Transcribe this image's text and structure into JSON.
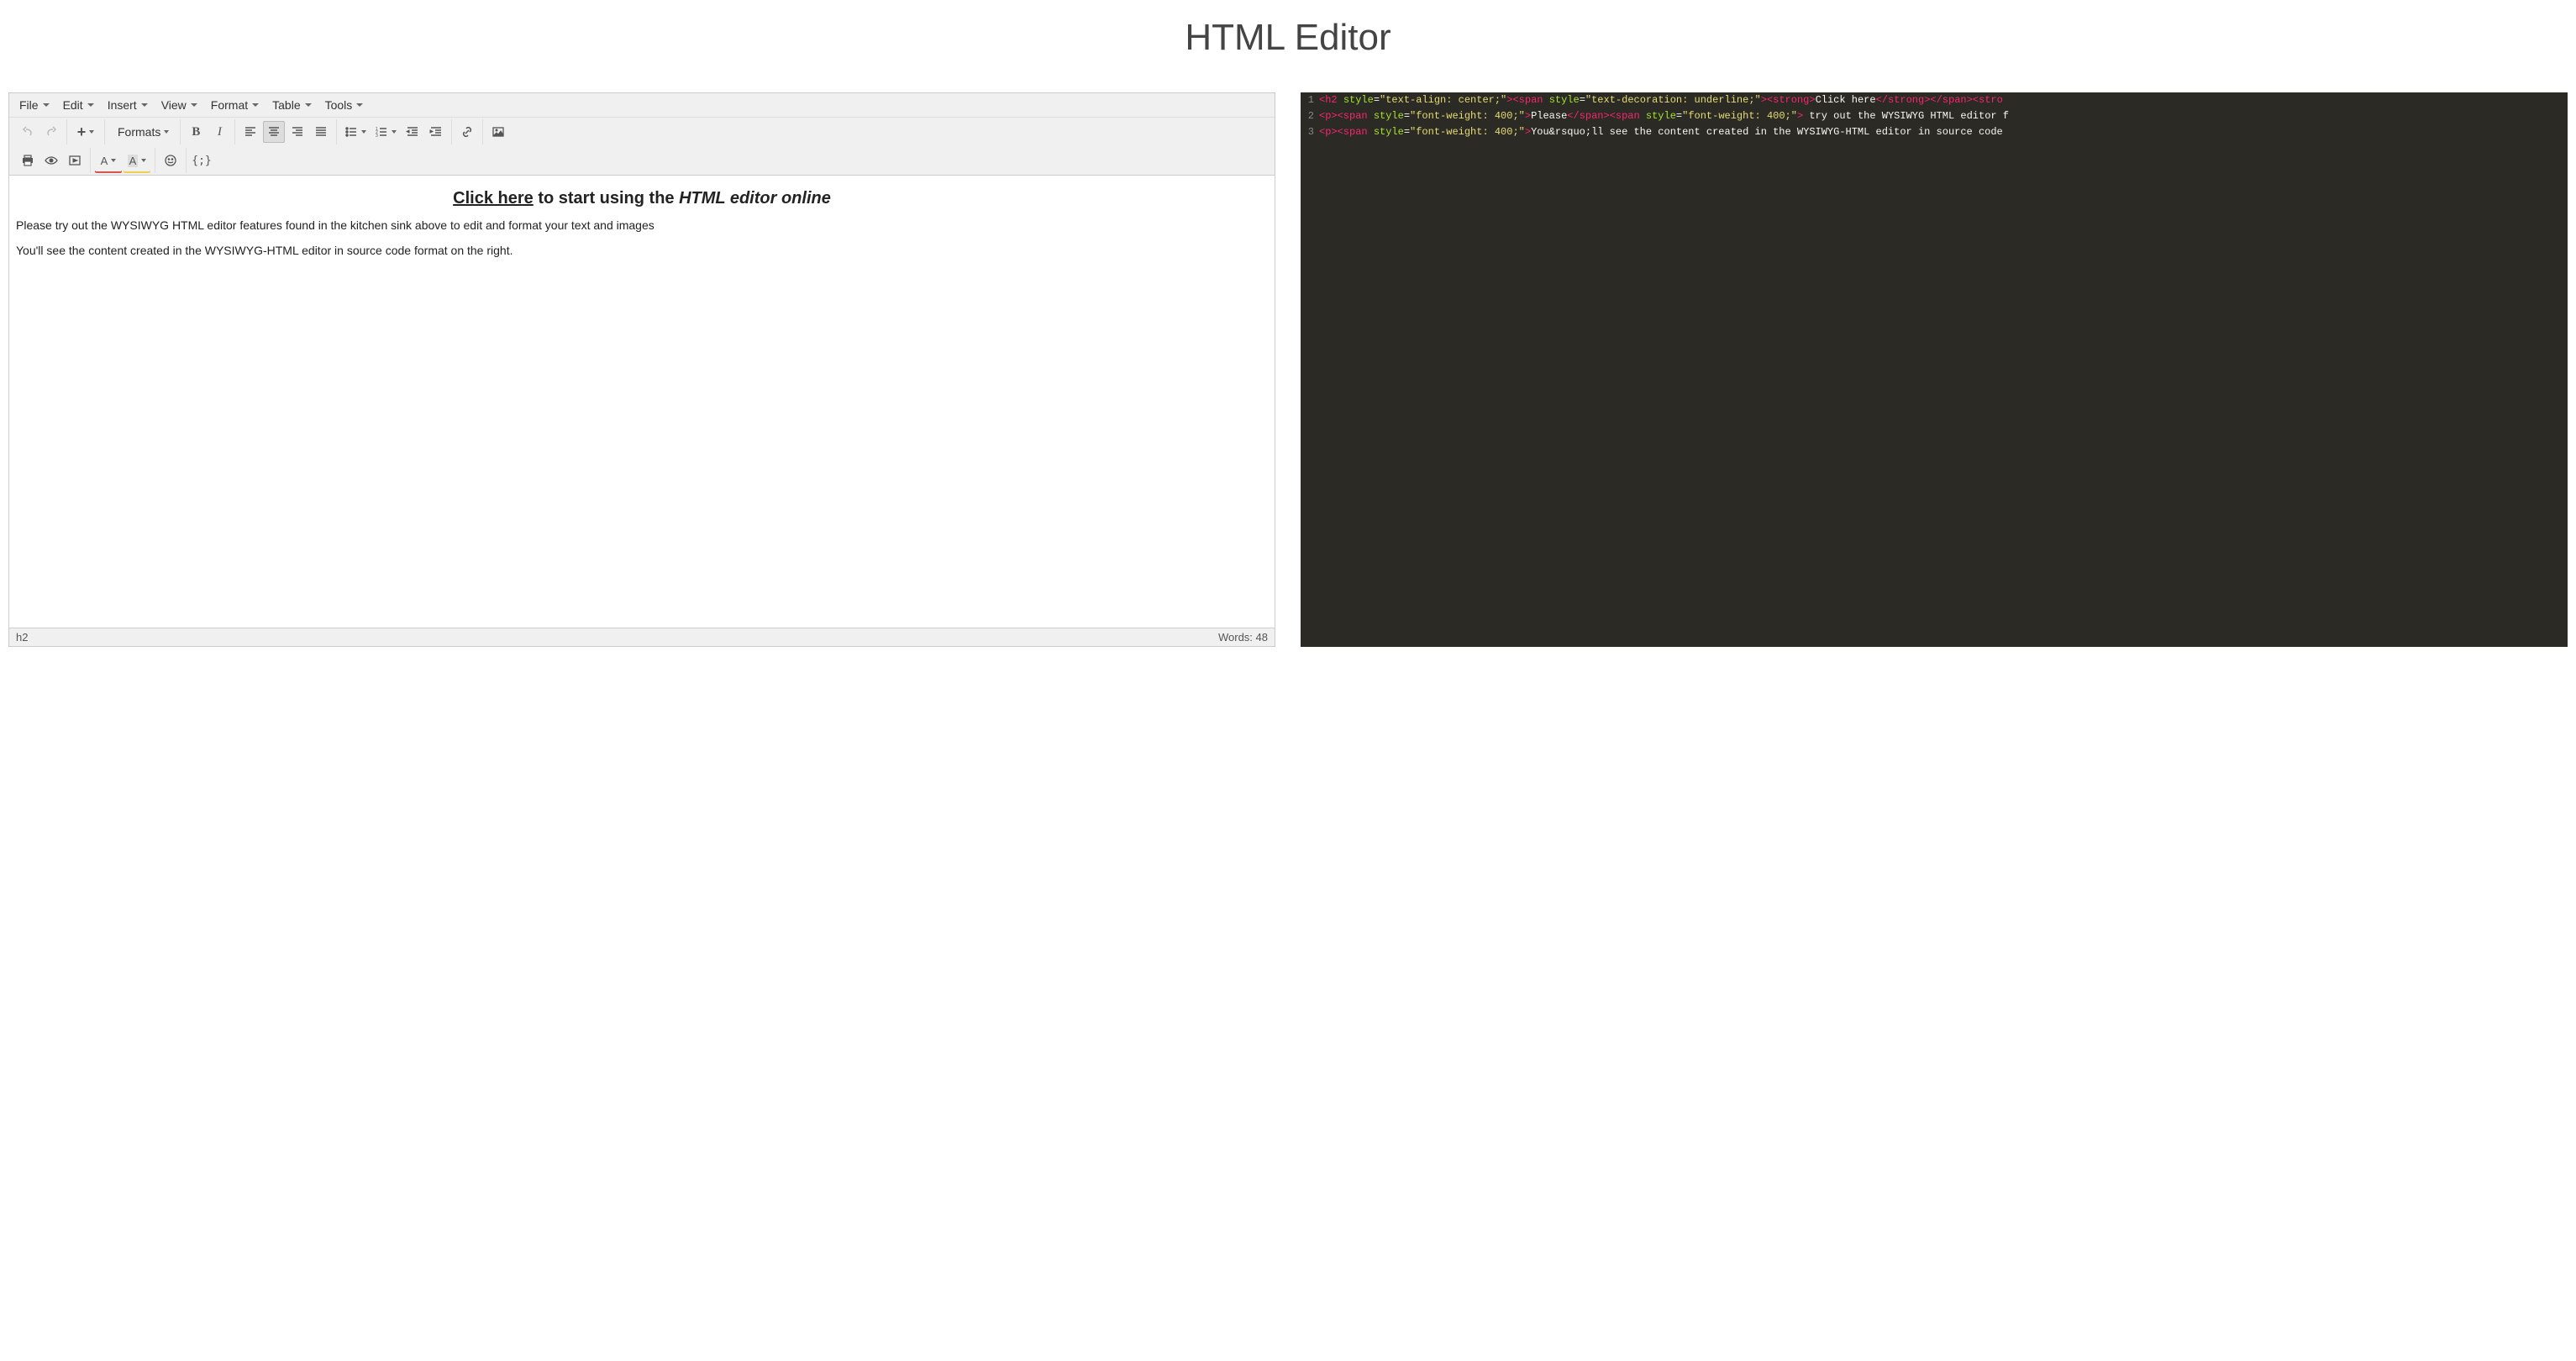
{
  "page": {
    "title": "HTML Editor"
  },
  "menubar": {
    "file": "File",
    "edit": "Edit",
    "insert": "Insert",
    "view": "View",
    "format": "Format",
    "table": "Table",
    "tools": "Tools"
  },
  "toolbar": {
    "formats_label": "Formats"
  },
  "content": {
    "h2_click": "Click here",
    "h2_rest": " to start using the ",
    "h2_italic": "HTML editor online",
    "p1": "Please try out the WYSIWYG HTML editor features found in the kitchen sink above to edit and format your text and images",
    "p2": "You'll see the content created in the WYSIWYG-HTML editor in source code format on the right."
  },
  "statusbar": {
    "path": "h2",
    "word_label": "Words: ",
    "word_count": "48"
  },
  "code": {
    "lines": [
      {
        "num": "1",
        "tokens": [
          {
            "c": "tag",
            "t": "<h2 "
          },
          {
            "c": "attr-n",
            "t": "style"
          },
          {
            "c": "op",
            "t": "="
          },
          {
            "c": "attr-v",
            "t": "\"text-align: center;\""
          },
          {
            "c": "tag",
            "t": "><span "
          },
          {
            "c": "attr-n",
            "t": "style"
          },
          {
            "c": "op",
            "t": "="
          },
          {
            "c": "attr-v",
            "t": "\"text-decoration: underline;\""
          },
          {
            "c": "tag",
            "t": "><strong>"
          },
          {
            "c": "txt",
            "t": "Click here"
          },
          {
            "c": "tag",
            "t": "</strong></span><stro"
          }
        ]
      },
      {
        "num": "2",
        "tokens": [
          {
            "c": "tag",
            "t": "<p><span "
          },
          {
            "c": "attr-n",
            "t": "style"
          },
          {
            "c": "op",
            "t": "="
          },
          {
            "c": "attr-v",
            "t": "\"font-weight: 400;\""
          },
          {
            "c": "tag",
            "t": ">"
          },
          {
            "c": "txt",
            "t": "Please"
          },
          {
            "c": "tag",
            "t": "</span><span "
          },
          {
            "c": "attr-n",
            "t": "style"
          },
          {
            "c": "op",
            "t": "="
          },
          {
            "c": "attr-v",
            "t": "\"font-weight: 400;\""
          },
          {
            "c": "tag",
            "t": ">"
          },
          {
            "c": "txt",
            "t": " try out the WYSIWYG HTML editor f"
          }
        ]
      },
      {
        "num": "3",
        "tokens": [
          {
            "c": "tag",
            "t": "<p><span "
          },
          {
            "c": "attr-n",
            "t": "style"
          },
          {
            "c": "op",
            "t": "="
          },
          {
            "c": "attr-v",
            "t": "\"font-weight: 400;\""
          },
          {
            "c": "tag",
            "t": ">"
          },
          {
            "c": "txt",
            "t": "You&rsquo;ll see the content created in the WYSIWYG-HTML editor in source code "
          }
        ]
      }
    ]
  }
}
